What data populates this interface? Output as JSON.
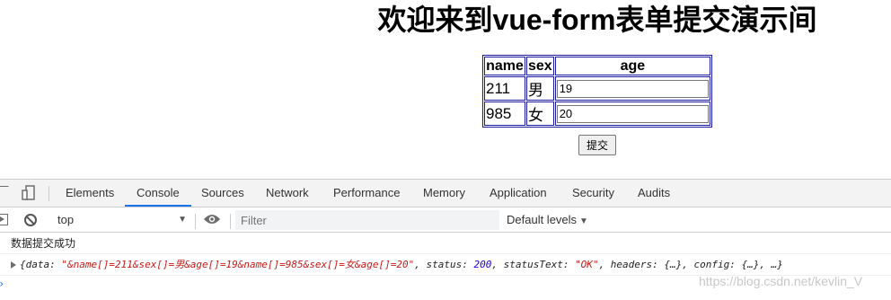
{
  "page": {
    "title": "欢迎来到vue-form表单提交演示间",
    "submit_label": "提交"
  },
  "table": {
    "headers": [
      "name",
      "sex",
      "age"
    ],
    "rows": [
      {
        "name": "211",
        "sex": "男",
        "age": "19"
      },
      {
        "name": "985",
        "sex": "女",
        "age": "20"
      }
    ]
  },
  "devtools": {
    "tabs": [
      "Elements",
      "Console",
      "Sources",
      "Network",
      "Performance",
      "Memory",
      "Application",
      "Security",
      "Audits"
    ],
    "active_tab": "Console",
    "context": "top",
    "filter_placeholder": "Filter",
    "levels": "Default levels",
    "console": {
      "log_message": "数据提交成功",
      "object_prefix": "{data: ",
      "data_value": "\"&name[]=211&sex[]=男&age[]=19&name[]=985&sex[]=女&age[]=20\"",
      "status_key": ", status: ",
      "status_value": "200",
      "status_text_key": ", statusText: ",
      "status_text_value": "\"OK\"",
      "suffix": ", headers: {…}, config: {…}, …}"
    },
    "accent_color": "#1a73e8"
  },
  "watermark": "https://blog.csdn.net/kevlin_V"
}
